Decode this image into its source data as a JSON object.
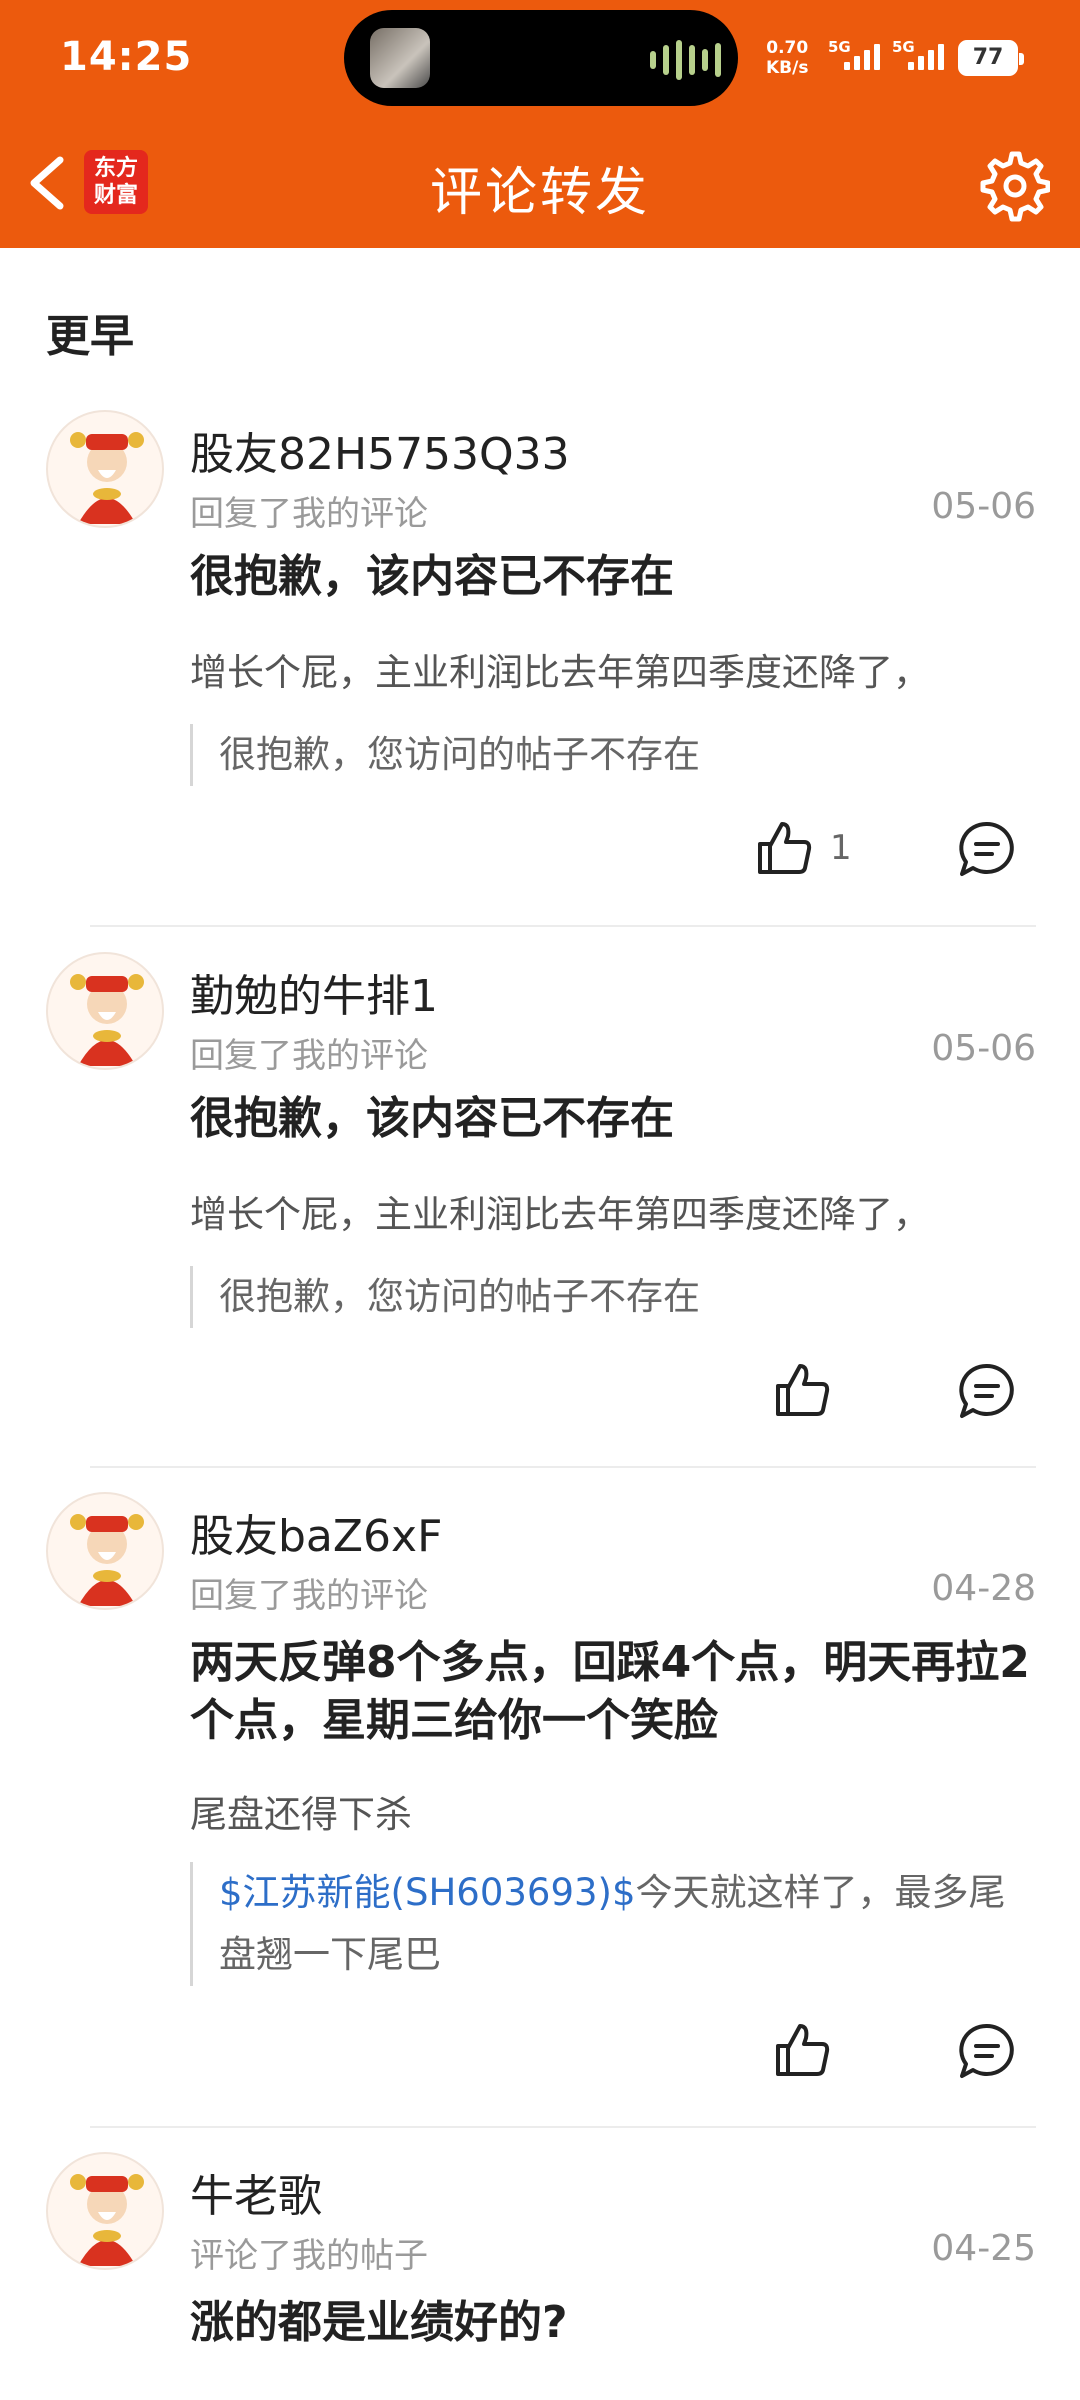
{
  "status_bar": {
    "time": "14:25",
    "net_speed_value": "0.70",
    "net_speed_unit": "KB/s",
    "signal1": "5G",
    "signal2": "5G",
    "battery": "77"
  },
  "header": {
    "back_icon": "chevron-left-icon",
    "logo_line1": "东方",
    "logo_line2": "财富",
    "title": "评论转发",
    "settings_icon": "gear-icon"
  },
  "section_title": "更早",
  "items": [
    {
      "user": "股友82H5753Q33",
      "action": "回复了我的评论",
      "date": "05-06",
      "post": " 很抱歉，该内容已不存在",
      "reply": "增长个屁，主业利润比去年第四季度还降了，",
      "quote": "很抱歉，您访问的帖子不存在",
      "likes": "1"
    },
    {
      "user": "勤勉的牛排1",
      "action": "回复了我的评论",
      "date": "05-06",
      "post": " 很抱歉，该内容已不存在",
      "reply": "增长个屁，主业利润比去年第四季度还降了，",
      "quote": "很抱歉，您访问的帖子不存在",
      "likes": ""
    },
    {
      "user": "股友baZ6xF",
      "action": "回复了我的评论",
      "date": "04-28",
      "post": "两天反弹8个多点，回踩4个点，明天再拉2个点，星期三给你一个笑脸",
      "reply": "尾盘还得下杀",
      "quote_link": "$江苏新能(SH603693)$",
      "quote_text": "今天就这样了，最多尾盘翘一下尾巴",
      "likes": ""
    },
    {
      "user": "牛老歌",
      "action": "评论了我的帖子",
      "date": "04-25",
      "post": "涨的都是业绩好的?"
    }
  ],
  "colors": {
    "brand": "#ec5a0d",
    "link": "#2d6ec8"
  }
}
